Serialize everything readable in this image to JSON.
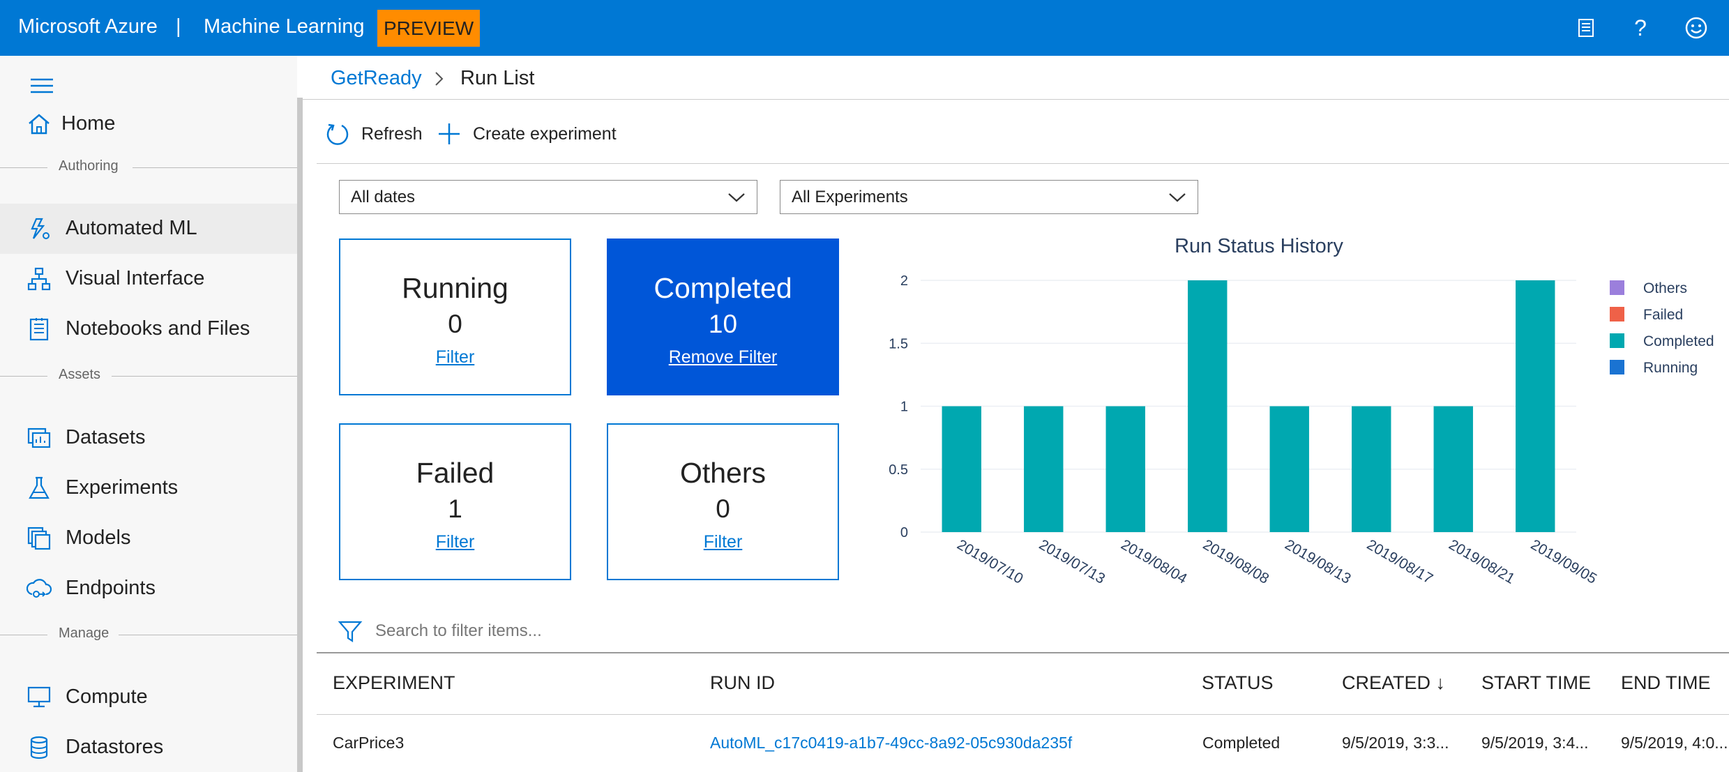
{
  "topbar": {
    "brand": "Microsoft Azure",
    "separator": "|",
    "product": "Machine Learning",
    "preview_badge": "PREVIEW",
    "icons": [
      "feedback-icon",
      "help-icon",
      "smiley-icon"
    ],
    "help_glyph": "?"
  },
  "sidebar": {
    "home": "Home",
    "sections": {
      "authoring": "Authoring",
      "assets": "Assets",
      "manage": "Manage"
    },
    "items": [
      {
        "label": "Automated ML",
        "icon": "automated-ml-icon",
        "active": true
      },
      {
        "label": "Visual Interface",
        "icon": "visual-interface-icon"
      },
      {
        "label": "Notebooks and Files",
        "icon": "notebook-icon"
      },
      {
        "label": "Datasets",
        "icon": "datasets-icon"
      },
      {
        "label": "Experiments",
        "icon": "flask-icon"
      },
      {
        "label": "Models",
        "icon": "models-icon"
      },
      {
        "label": "Endpoints",
        "icon": "endpoints-icon"
      },
      {
        "label": "Compute",
        "icon": "compute-icon"
      },
      {
        "label": "Datastores",
        "icon": "datastore-icon"
      }
    ]
  },
  "breadcrumb": {
    "parent": "GetReady",
    "current": "Run List"
  },
  "toolbar": {
    "refresh": "Refresh",
    "create": "Create experiment"
  },
  "filters": {
    "dates": "All dates",
    "experiments": "All Experiments"
  },
  "status_cards": [
    {
      "title": "Running",
      "count": "0",
      "link": "Filter",
      "selected": false
    },
    {
      "title": "Completed",
      "count": "10",
      "link": "Remove Filter",
      "selected": true
    },
    {
      "title": "Failed",
      "count": "1",
      "link": "Filter",
      "selected": false
    },
    {
      "title": "Others",
      "count": "0",
      "link": "Filter",
      "selected": false
    }
  ],
  "colors": {
    "accent": "#0078d4",
    "selected_card": "#0056d8",
    "preview": "#ff8c00",
    "others": "#9b7fdc",
    "failed": "#ef6148",
    "completed": "#00a8b0",
    "running": "#1a73d2"
  },
  "chart_data": {
    "type": "bar",
    "title": "Run Status History",
    "categories": [
      "2019/07/10",
      "2019/07/13",
      "2019/08/04",
      "2019/08/08",
      "2019/08/13",
      "2019/08/17",
      "2019/08/21",
      "2019/09/05"
    ],
    "series": [
      {
        "name": "Others",
        "values": [
          0,
          0,
          0,
          0,
          0,
          0,
          0,
          0
        ]
      },
      {
        "name": "Failed",
        "values": [
          0,
          0,
          0,
          0,
          0,
          0,
          0,
          0
        ]
      },
      {
        "name": "Completed",
        "values": [
          1,
          1,
          1,
          2,
          1,
          1,
          1,
          2
        ]
      },
      {
        "name": "Running",
        "values": [
          0,
          0,
          0,
          0,
          0,
          0,
          0,
          0
        ]
      }
    ],
    "y_ticks": [
      "0",
      "0.5",
      "1",
      "1.5",
      "2"
    ],
    "ylim": [
      0,
      2
    ],
    "stacked": true,
    "grid": true,
    "legend": "right"
  },
  "search": {
    "placeholder": "Search to filter items..."
  },
  "table": {
    "columns": [
      "EXPERIMENT",
      "RUN ID",
      "STATUS",
      "CREATED ↓",
      "START TIME",
      "END TIME"
    ],
    "rows": [
      [
        "CarPrice3",
        "AutoML_c17c0419-a1b7-49cc-8a92-05c930da235f",
        "Completed",
        "9/5/2019, 3:3...",
        "9/5/2019, 3:4...",
        "9/5/2019, 4:0..."
      ]
    ]
  }
}
